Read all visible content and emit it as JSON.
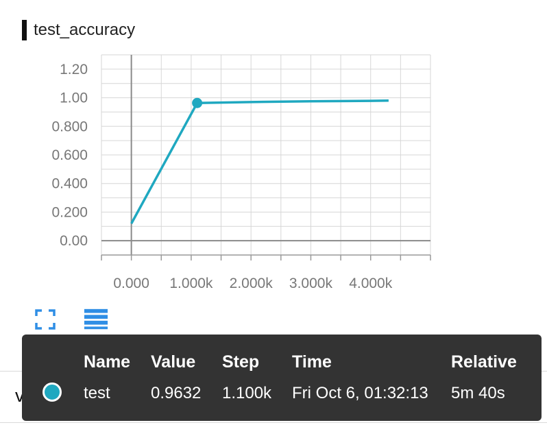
{
  "card": {
    "title": "test_accuracy"
  },
  "chart_data": {
    "type": "line",
    "title": "",
    "xlabel": "",
    "ylabel": "",
    "xlim": [
      -500,
      5000
    ],
    "ylim": [
      -0.1,
      1.3
    ],
    "x_ticks": [
      0,
      1000,
      2000,
      3000,
      4000
    ],
    "x_tick_labels": [
      "0.000",
      "1.000k",
      "2.000k",
      "3.000k",
      "4.000k"
    ],
    "y_ticks": [
      0,
      0.2,
      0.4,
      0.6,
      0.8,
      1.0,
      1.2
    ],
    "y_tick_labels": [
      "0.00",
      "0.200",
      "0.400",
      "0.600",
      "0.800",
      "1.00",
      "1.20"
    ],
    "grid": true,
    "series": [
      {
        "name": "test",
        "color": "#1fa8c0",
        "x": [
          0,
          1100,
          2000,
          3000,
          4000,
          4300
        ],
        "y": [
          0.12,
          0.9632,
          0.97,
          0.975,
          0.978,
          0.98
        ]
      }
    ],
    "highlight": {
      "x": 1100,
      "y": 0.9632
    }
  },
  "controls": {
    "expand_icon": "fullscreen-icon",
    "menu_icon": "list-icon"
  },
  "next_card": {
    "title": "val_accuracy"
  },
  "tooltip": {
    "headers": {
      "name": "Name",
      "value": "Value",
      "step": "Step",
      "time": "Time",
      "relative": "Relative"
    },
    "row": {
      "color": "#1fa8c0",
      "name": "test",
      "value": "0.9632",
      "step": "1.100k",
      "time": "Fri Oct 6, 01:32:13",
      "relative": "5m 40s"
    }
  }
}
